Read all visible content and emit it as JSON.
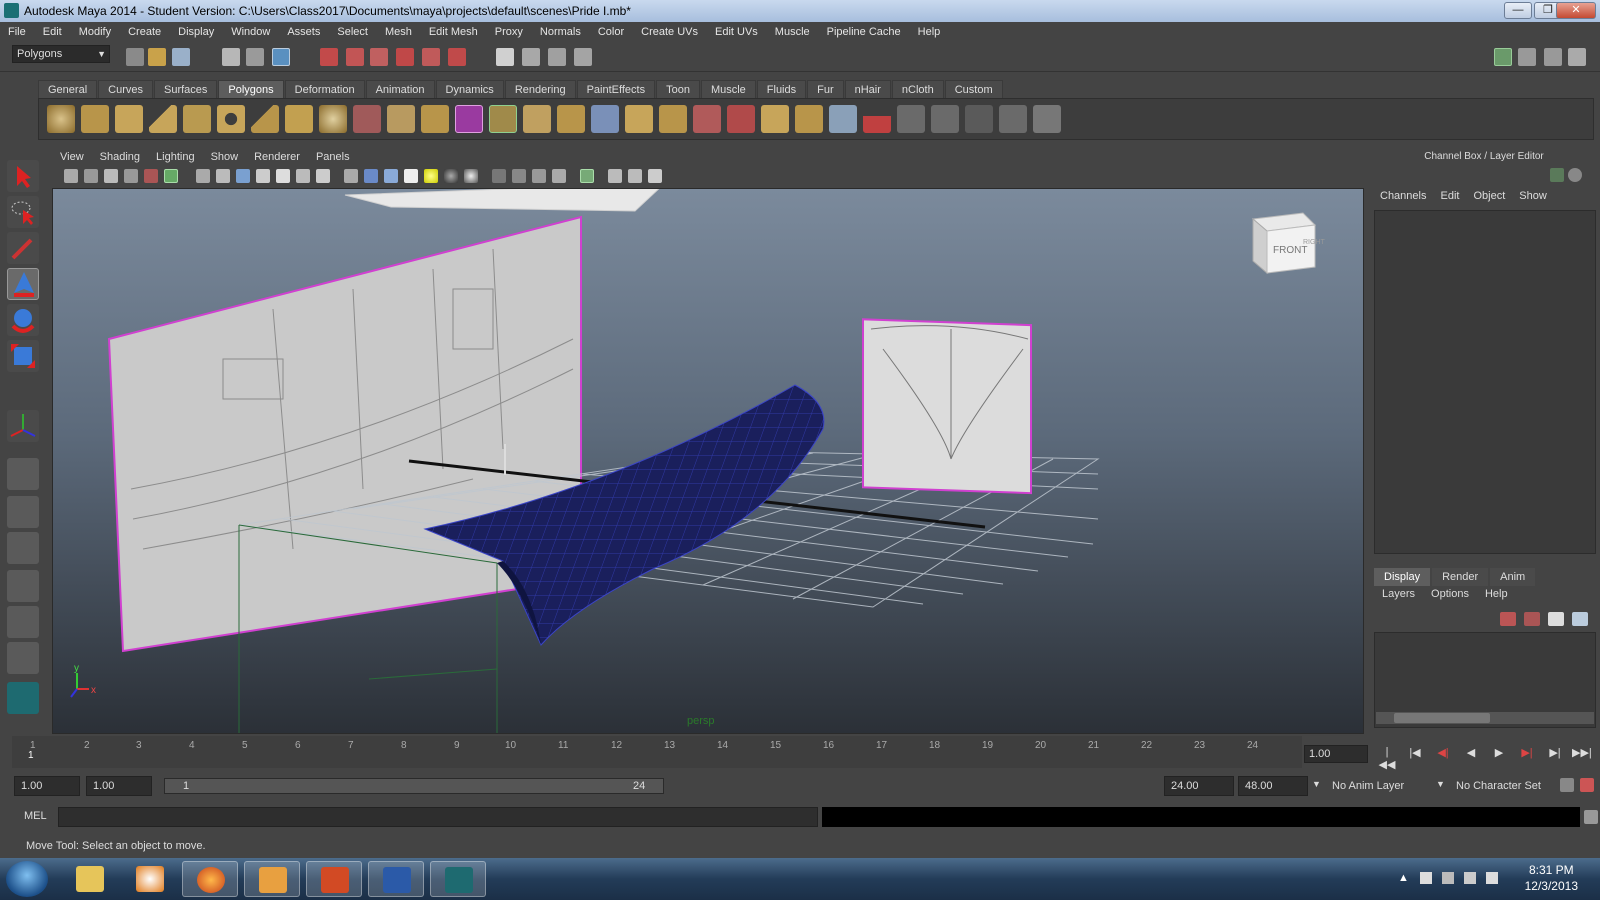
{
  "window": {
    "title": "Autodesk Maya 2014 - Student Version: C:\\Users\\Class2017\\Documents\\maya\\projects\\default\\scenes\\Pride I.mb*",
    "min_label": "—",
    "max_label": "❐",
    "close_label": "✕"
  },
  "menubar": [
    "File",
    "Edit",
    "Modify",
    "Create",
    "Display",
    "Window",
    "Assets",
    "Select",
    "Mesh",
    "Edit Mesh",
    "Proxy",
    "Normals",
    "Color",
    "Create UVs",
    "Edit UVs",
    "Muscle",
    "Pipeline Cache",
    "Help"
  ],
  "statusline": {
    "mode": "Polygons",
    "mode_arrow": "▼"
  },
  "shelf": {
    "tabs": [
      "General",
      "Curves",
      "Surfaces",
      "Polygons",
      "Deformation",
      "Animation",
      "Dynamics",
      "Rendering",
      "PaintEffects",
      "Toon",
      "Muscle",
      "Fluids",
      "Fur",
      "nHair",
      "nCloth",
      "Custom"
    ],
    "active_tab": "Polygons"
  },
  "viewport": {
    "menu": [
      "View",
      "Shading",
      "Lighting",
      "Show",
      "Renderer",
      "Panels"
    ],
    "camera_label": "persp",
    "viewcube_front": "FRONT",
    "viewcube_right": "RIGHT",
    "axis_y": "y",
    "axis_x": "x",
    "colors": {
      "gradient_top": "#7b8a9c",
      "gradient_bottom": "#2b3037",
      "mesh": "#1a1f5c",
      "wire": "#3a44c8",
      "selection": "#d040d0"
    }
  },
  "channel_box": {
    "title": "Channel Box / Layer Editor",
    "menu": [
      "Channels",
      "Edit",
      "Object",
      "Show"
    ]
  },
  "layer_editor": {
    "tabs": [
      "Display",
      "Render",
      "Anim"
    ],
    "active_tab": "Display",
    "menu": [
      "Layers",
      "Options",
      "Help"
    ]
  },
  "timeline": {
    "ticks": [
      "1",
      "2",
      "3",
      "4",
      "5",
      "6",
      "7",
      "8",
      "9",
      "10",
      "11",
      "12",
      "13",
      "14",
      "15",
      "16",
      "17",
      "18",
      "19",
      "20",
      "21",
      "22",
      "23",
      "24"
    ],
    "current_frame": "1",
    "current_time_field": "1.00",
    "playback": [
      "|◀◀",
      "|◀",
      "◀|",
      "◀",
      "▶",
      "▶|",
      "▶|",
      "▶▶|"
    ]
  },
  "range": {
    "start_time": "1.00",
    "playback_start": "1.00",
    "range_start_label": "1",
    "range_end_label": "24",
    "playback_end": "24.00",
    "end_time": "48.00",
    "anim_layer": "No Anim Layer",
    "character_set": "No Character Set"
  },
  "command_line": {
    "label": "MEL"
  },
  "help_line": "Move Tool: Select an object to move.",
  "taskbar": {
    "clock_time": "8:31 PM",
    "clock_date": "12/3/2013",
    "apps": [
      "explorer",
      "media-player",
      "firefox",
      "outlook",
      "powerpoint",
      "word",
      "maya"
    ]
  }
}
